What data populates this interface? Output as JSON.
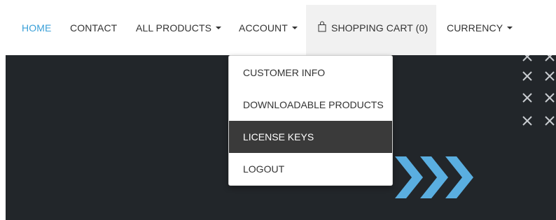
{
  "nav": {
    "home": "HOME",
    "contact": "CONTACT",
    "all_products": "ALL PRODUCTS",
    "account": "ACCOUNT",
    "shopping_cart": "SHOPPING CART (0)",
    "currency": "CURRENCY"
  },
  "account_menu": {
    "items": [
      {
        "label": "CUSTOMER INFO"
      },
      {
        "label": "DOWNLOADABLE PRODUCTS"
      },
      {
        "label": "LICENSE KEYS",
        "highlighted": true
      },
      {
        "label": "LOGOUT"
      }
    ]
  },
  "icons": {
    "cart": "shopping-bag-icon",
    "dropdown": "caret-down-icon",
    "decoration": "x-mark-icon",
    "arrows": "chevrons-right-icon"
  },
  "colors": {
    "active_link": "#3aa0d8",
    "hero_background": "#22262a",
    "menu_highlight": "#3a3a3a",
    "chevron": "#5aaee0",
    "cart_background": "#f1f1f1"
  }
}
